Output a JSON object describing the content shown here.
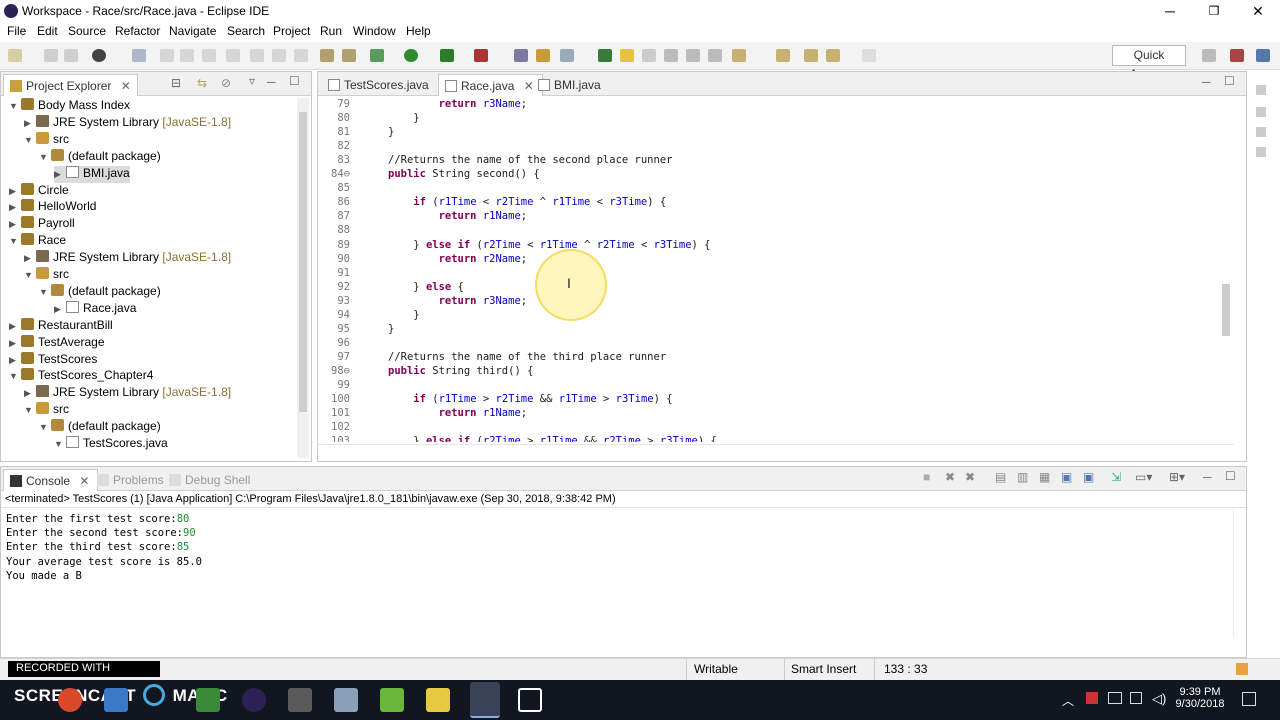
{
  "window": {
    "title": "Workspace - Race/src/Race.java - Eclipse IDE",
    "minimize": "─",
    "restore": "❐",
    "close": "✕"
  },
  "menu": [
    "File",
    "Edit",
    "Source",
    "Refactor",
    "Navigate",
    "Search",
    "Project",
    "Run",
    "Window",
    "Help"
  ],
  "toolbar": {
    "quick_access": "Quick Access"
  },
  "project_explorer": {
    "title": "Project Explorer",
    "items": [
      {
        "label": "Body Mass Index",
        "icon": "project-icon",
        "expanded": true
      },
      {
        "label": "JRE System Library",
        "suffix": "[JavaSE-1.8]",
        "icon": "library-icon"
      },
      {
        "label": "src",
        "icon": "source-folder-icon",
        "expanded": true
      },
      {
        "label": "(default package)",
        "icon": "package-icon",
        "expanded": true
      },
      {
        "label": "BMI.java",
        "icon": "java-file-icon",
        "selected": true
      },
      {
        "label": "Circle",
        "icon": "project-icon"
      },
      {
        "label": "HelloWorld",
        "icon": "project-icon"
      },
      {
        "label": "Payroll",
        "icon": "project-icon"
      },
      {
        "label": "Race",
        "icon": "project-icon",
        "expanded": true
      },
      {
        "label": "JRE System Library",
        "suffix": "[JavaSE-1.8]",
        "icon": "library-icon"
      },
      {
        "label": "src",
        "icon": "source-folder-icon",
        "expanded": true
      },
      {
        "label": "(default package)",
        "icon": "package-icon",
        "expanded": true
      },
      {
        "label": "Race.java",
        "icon": "java-file-icon"
      },
      {
        "label": "RestaurantBill",
        "icon": "project-icon"
      },
      {
        "label": "TestAverage",
        "icon": "project-icon"
      },
      {
        "label": "TestScores",
        "icon": "project-icon"
      },
      {
        "label": "TestScores_Chapter4",
        "icon": "project-icon",
        "expanded": true
      },
      {
        "label": "JRE System Library",
        "suffix": "[JavaSE-1.8]",
        "icon": "library-icon"
      },
      {
        "label": "src",
        "icon": "source-folder-icon",
        "expanded": true
      },
      {
        "label": "(default package)",
        "icon": "package-icon",
        "expanded": true
      },
      {
        "label": "TestScores.java",
        "icon": "java-file-icon",
        "expanded": true
      }
    ]
  },
  "editor": {
    "tabs": [
      {
        "label": "TestScores.java"
      },
      {
        "label": "Race.java",
        "active": true
      },
      {
        "label": "BMI.java"
      }
    ],
    "lines": [
      {
        "n": "79",
        "text": "        return r3Name;"
      },
      {
        "n": "80",
        "text": "    }"
      },
      {
        "n": "81",
        "text": "}"
      },
      {
        "n": "82",
        "text": ""
      },
      {
        "n": "83",
        "text": "//Returns the name of the second place runner"
      },
      {
        "n": "84⊖",
        "text": "public String second() {"
      },
      {
        "n": "85",
        "text": ""
      },
      {
        "n": "86",
        "text": "    if (r1Time < r2Time ^ r1Time < r3Time) {"
      },
      {
        "n": "87",
        "text": "        return r1Name;"
      },
      {
        "n": "88",
        "text": ""
      },
      {
        "n": "89",
        "text": "    } else if (r2Time < r1Time ^ r2Time < r3Time) {"
      },
      {
        "n": "90",
        "text": "        return r2Name;"
      },
      {
        "n": "91",
        "text": ""
      },
      {
        "n": "92",
        "text": "    } else {"
      },
      {
        "n": "93",
        "text": "        return r3Name;"
      },
      {
        "n": "94",
        "text": "    }"
      },
      {
        "n": "95",
        "text": "}"
      },
      {
        "n": "96",
        "text": ""
      },
      {
        "n": "97",
        "text": "//Returns the name of the third place runner"
      },
      {
        "n": "98⊖",
        "text": "public String third() {"
      },
      {
        "n": "99",
        "text": ""
      },
      {
        "n": "100",
        "text": "    if (r1Time > r2Time && r1Time > r3Time) {"
      },
      {
        "n": "101",
        "text": "        return r1Name;"
      },
      {
        "n": "102",
        "text": ""
      },
      {
        "n": "103",
        "text": "    } else if (r2Time > r1Time && r2Time > r3Time) {"
      }
    ]
  },
  "console": {
    "tabs": [
      "Console",
      "Problems",
      "Debug Shell"
    ],
    "header": "<terminated> TestScores (1) [Java Application] C:\\Program Files\\Java\\jre1.8.0_181\\bin\\javaw.exe (Sep 30, 2018, 9:38:42 PM)",
    "lines": [
      {
        "text": "Enter the first test score:",
        "input": "80"
      },
      {
        "text": "Enter the second test score:",
        "input": "90"
      },
      {
        "text": "Enter the third test score:",
        "input": "85"
      },
      {
        "text": "Your average test score is 85.0",
        "input": ""
      },
      {
        "text": "You made a B",
        "input": ""
      }
    ]
  },
  "status": {
    "writable": "Writable",
    "insert_mode": "Smart Insert",
    "position": "133 : 33"
  },
  "watermark": "RECORDED WITH",
  "watermark_brand": "SCREENCAST",
  "watermark_brand2": "MATIC",
  "taskbar": {
    "time": "9:39 PM",
    "date": "9/30/2018"
  }
}
